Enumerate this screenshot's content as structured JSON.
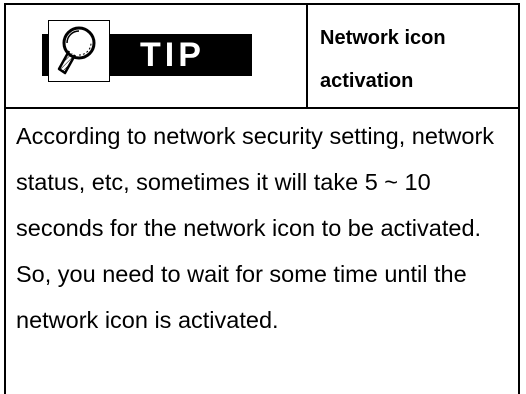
{
  "tip": {
    "badge_label": "TIP",
    "badge_icon": "magnifier-icon",
    "title": "Network icon activation",
    "body": "According to network security setting, network status, etc, sometimes it will take 5 ~ 10 seconds for the network icon to be activated. So, you need to wait for some time until the network icon is activated."
  },
  "colors": {
    "border": "#000000",
    "badge_background": "#000000",
    "badge_text": "#ffffff",
    "page_background": "#ffffff"
  }
}
